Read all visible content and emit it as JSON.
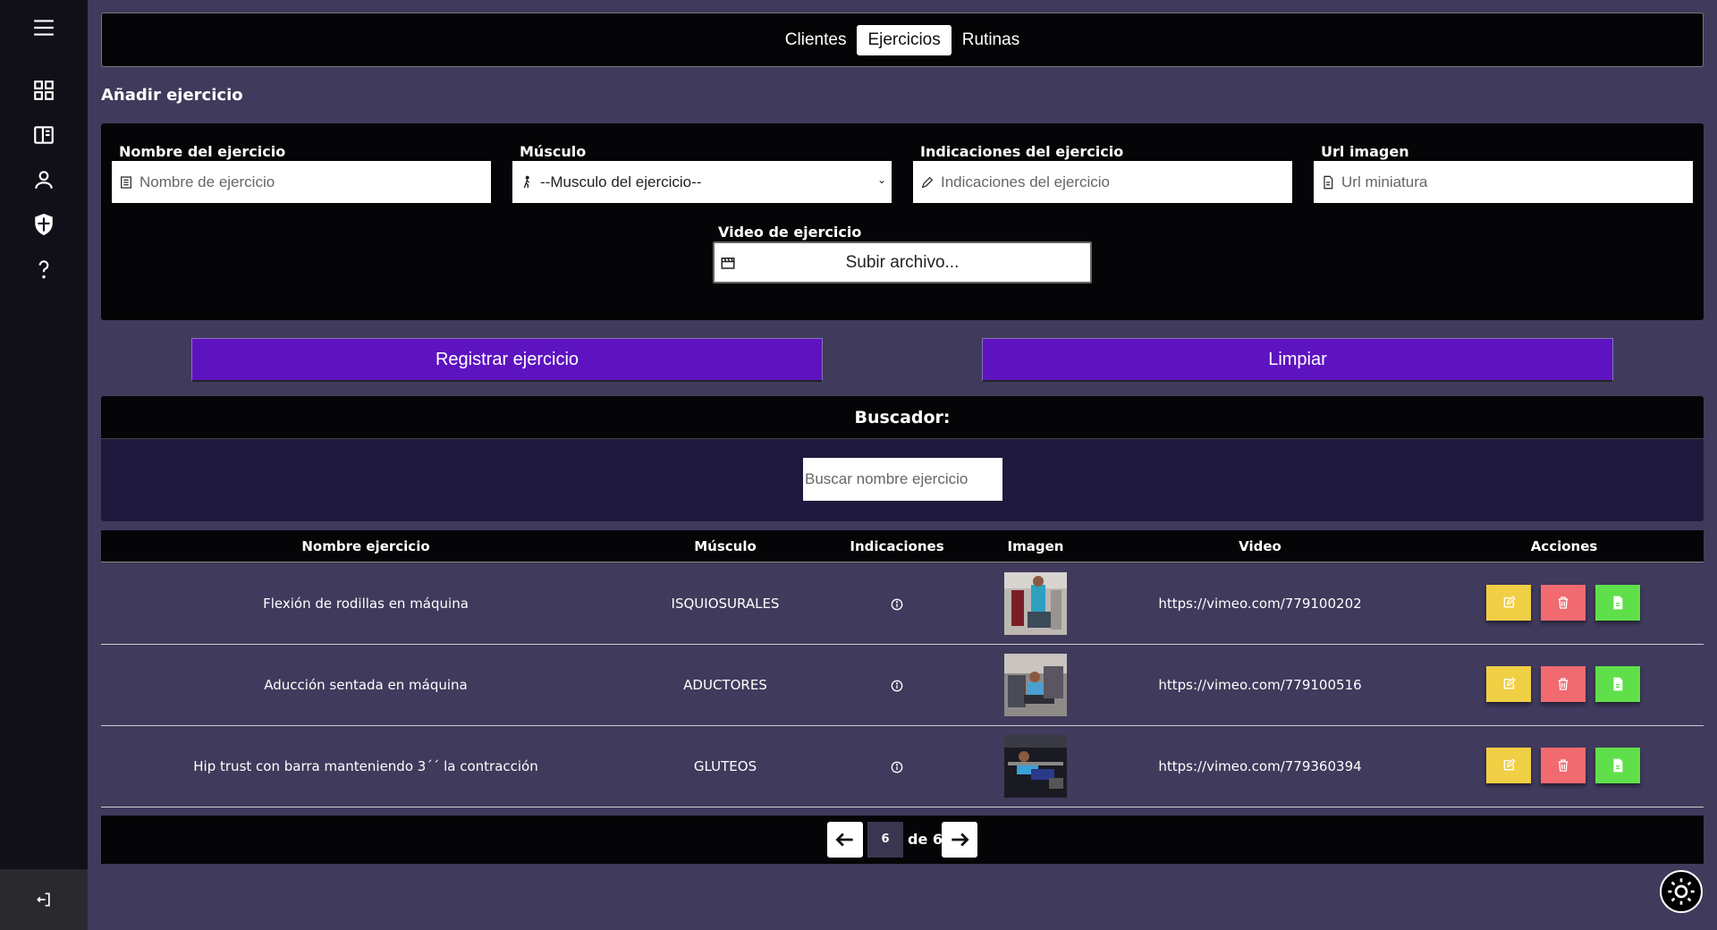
{
  "tabs": [
    "Clientes",
    "Ejercicios",
    "Rutinas"
  ],
  "section_title": "Añadir ejercicio",
  "form": {
    "name": {
      "label": "Nombre del ejercicio",
      "placeholder": "Nombre de ejercicio"
    },
    "muscle": {
      "label": "Músculo",
      "selected": "--Musculo del ejercicio--"
    },
    "indications": {
      "label": "Indicaciones del ejercicio",
      "placeholder": "Indicaciones del ejercicio"
    },
    "image_url": {
      "label": "Url imagen",
      "placeholder": "Url miniatura"
    },
    "video": {
      "label": "Video de ejercicio",
      "button": "Subir archivo..."
    }
  },
  "buttons": {
    "register": "Registrar ejercicio",
    "clear": "Limpiar"
  },
  "search": {
    "title": "Buscador:",
    "placeholder": "Buscar nombre ejercicio"
  },
  "table": {
    "headers": [
      "Nombre ejercicio",
      "Músculo",
      "Indicaciones",
      "Imagen",
      "Video",
      "Acciones"
    ],
    "rows": [
      {
        "name": "Flexión de rodillas en máquina",
        "muscle": "ISQUIOSURALES",
        "video": "https://vimeo.com/779100202"
      },
      {
        "name": "Aducción sentada en máquina",
        "muscle": "ADUCTORES",
        "video": "https://vimeo.com/779100516"
      },
      {
        "name": "Hip trust con barra manteniendo 3´´ la contracción",
        "muscle": "GLUTEOS",
        "video": "https://vimeo.com/779360394"
      }
    ]
  },
  "pagination": {
    "current": "6",
    "of_label": "de 6"
  },
  "colors": {
    "accent": "#5e13c0",
    "background": "#403a5c",
    "sidebar": "#111019",
    "edit": "#f0cf45",
    "delete": "#f06a70",
    "doc": "#5fe04a"
  }
}
